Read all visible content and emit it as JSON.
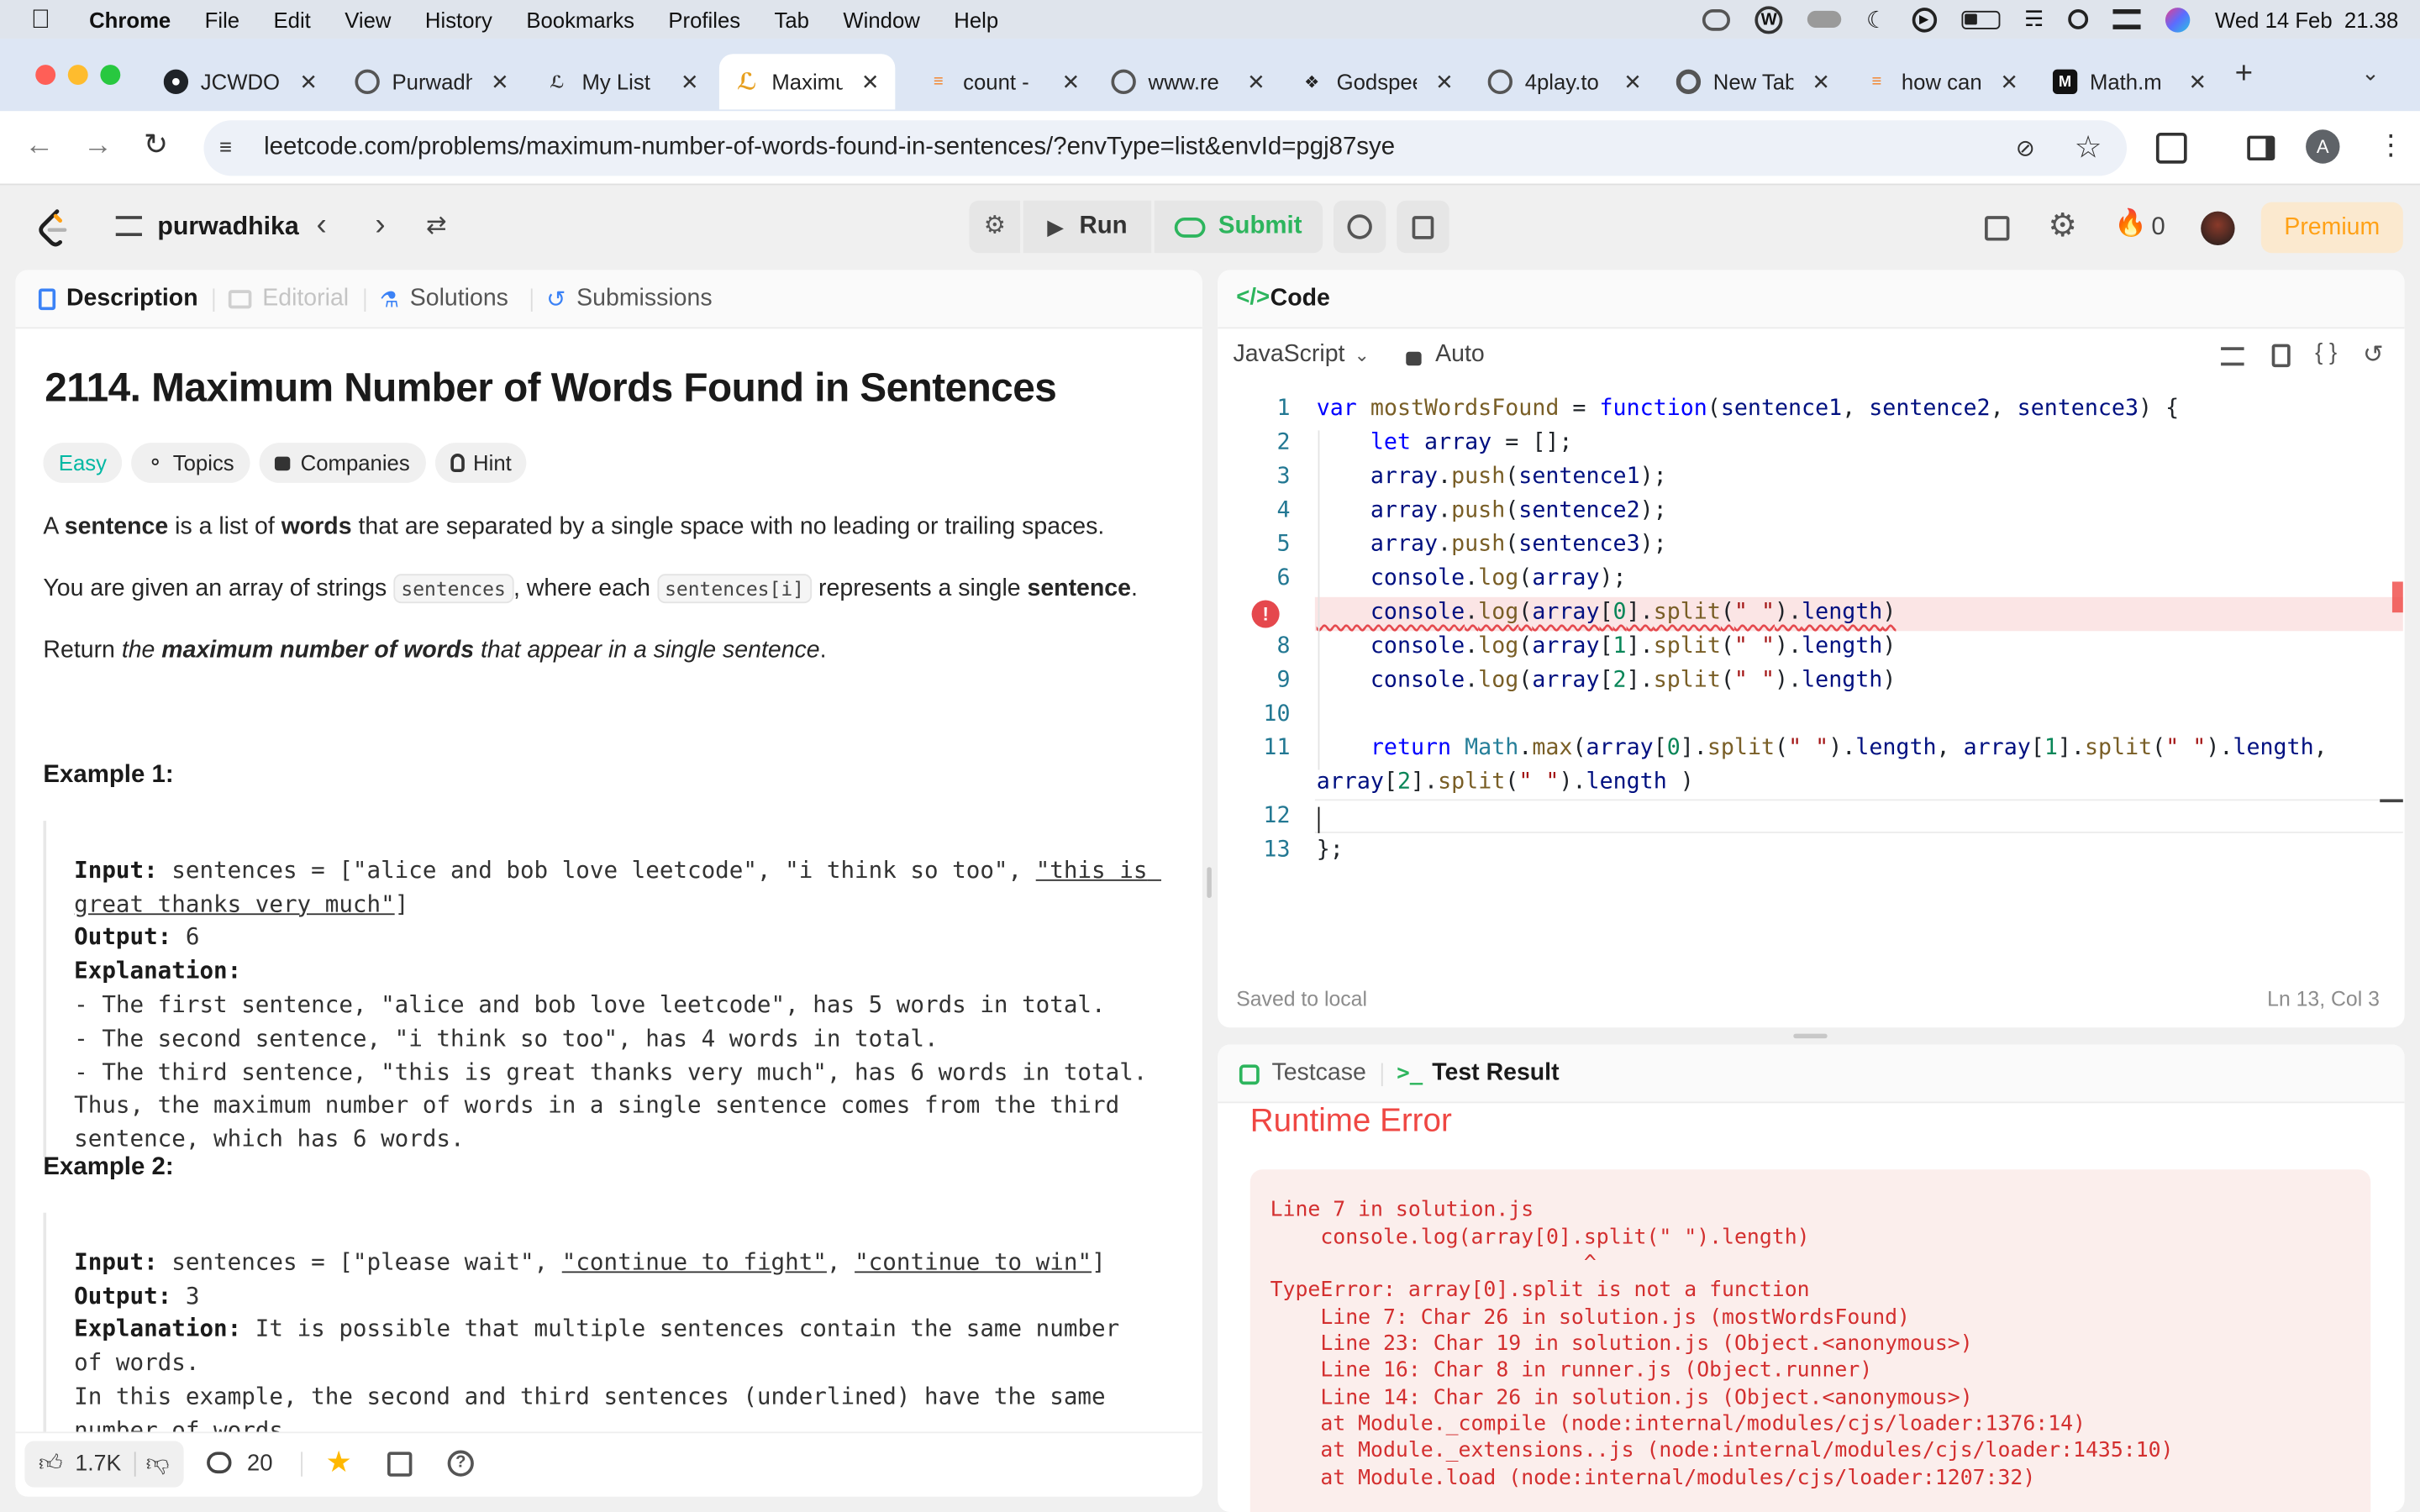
{
  "menubar": {
    "app": "Chrome",
    "items": [
      "File",
      "Edit",
      "View",
      "History",
      "Bookmarks",
      "Profiles",
      "Tab",
      "Window",
      "Help"
    ],
    "clock": "Wed 14 Feb  21.38"
  },
  "tabs": [
    {
      "title": "JCWDO",
      "icon": "github-icon"
    },
    {
      "title": "Purwadhika",
      "icon": "purwadhika-icon"
    },
    {
      "title": "My List",
      "icon": "leetcode-icon"
    },
    {
      "title": "Maximum",
      "icon": "leetcode-icon"
    },
    {
      "title": "count -",
      "icon": "stackoverflow-icon"
    },
    {
      "title": "www.re",
      "icon": "globe-icon"
    },
    {
      "title": "Godspeed",
      "icon": "godspeed-icon"
    },
    {
      "title": "4play.to",
      "icon": "globe-icon"
    },
    {
      "title": "New Tab",
      "icon": "chrome-icon"
    },
    {
      "title": "how can",
      "icon": "stackoverflow-icon"
    },
    {
      "title": "Math.m",
      "icon": "mdn-icon"
    }
  ],
  "address": {
    "url": "leetcode.com/problems/maximum-number-of-words-found-in-sentences/?envType=list&envId=pgj87sye",
    "profile_initial": "A"
  },
  "lc_header": {
    "list_name": "purwadhika",
    "run_label": "Run",
    "submit_label": "Submit",
    "streak": "0",
    "premium_label": "Premium"
  },
  "left_tabs": {
    "description": "Description",
    "editorial": "Editorial",
    "solutions": "Solutions",
    "submissions": "Submissions"
  },
  "problem": {
    "title": "2114. Maximum Number of Words Found in Sentences",
    "difficulty": "Easy",
    "tags": [
      "Topics",
      "Companies",
      "Hint"
    ],
    "p1_a": "A ",
    "p1_b": "sentence",
    "p1_c": " is a list of ",
    "p1_d": "words",
    "p1_e": " that are separated by a single space with no leading or trailing spaces.",
    "p2_a": "You are given an array of strings ",
    "p2_code1": "sentences",
    "p2_b": ", where each ",
    "p2_code2": "sentences[i]",
    "p2_c": " represents a single ",
    "p2_d": "sentence",
    ".": ".",
    "p3_a": "Return ",
    "p3_b": "the ",
    "p3_c": "maximum number of words",
    "p3_d": " that appear in a single sentence",
    "ex1_title": "Example 1:",
    "ex2_title": "Example 2:",
    "input_label": "Input:",
    "output_label": "Output:",
    "explanation_label": "Explanation:",
    "ex1_input": " sentences = [\"alice and bob love leetcode\", \"i think so too\", ",
    "ex1_input_u": "\"this is great thanks very much\"",
    "ex1_input_end": "]",
    "ex1_output": " 6",
    "ex1_expl": "- The first sentence, \"alice and bob love leetcode\", has 5 words in total.\n- The second sentence, \"i think so too\", has 4 words in total.\n- The third sentence, \"this is great thanks very much\", has 6 words in total.\nThus, the maximum number of words in a single sentence comes from the third\nsentence, which has 6 words.",
    "ex2_input": " sentences = [\"please wait\", ",
    "ex2_input_u1": "\"continue to fight\"",
    "ex2_sep": ", ",
    "ex2_input_u2": "\"continue to win\"",
    "ex2_input_end": "]",
    "ex2_output": " 3",
    "ex2_expl": " It is possible that multiple sentences contain the same number\nof words.\nIn this example, the second and third sentences (underlined) have the same\nnumber of words."
  },
  "footer": {
    "likes": "1.7K",
    "comments": "20"
  },
  "code_panel": {
    "title": "Code",
    "language": "JavaScript",
    "mode": "Auto",
    "saved": "Saved to local",
    "cursor": "Ln 13, Col 3",
    "line_numbers": [
      "1",
      "2",
      "3",
      "4",
      "5",
      "6",
      "",
      "8",
      "9",
      "10",
      "11",
      "12",
      "13"
    ]
  },
  "result_panel": {
    "testcase_tab": "Testcase",
    "result_tab": "Test Result",
    "status": "Runtime Error",
    "error_lines": [
      "Line 7 in solution.js",
      "    console.log(array[0].split(\" \").length)",
      "                         ^",
      "TypeError: array[0].split is not a function",
      "    Line 7: Char 26 in solution.js (mostWordsFound)",
      "    Line 23: Char 19 in solution.js (Object.<anonymous>)",
      "    Line 16: Char 8 in runner.js (Object.runner)",
      "    Line 14: Char 26 in solution.js (Object.<anonymous>)",
      "    at Module._compile (node:internal/modules/cjs/loader:1376:14)",
      "    at Module._extensions..js (node:internal/modules/cjs/loader:1435:10)",
      "    at Module.load (node:internal/modules/cjs/loader:1207:32)"
    ]
  },
  "colors": {
    "accent": "#ffa116",
    "run_green": "#2db55d",
    "error_red": "#ef4743",
    "easy": "#00b8a3"
  }
}
